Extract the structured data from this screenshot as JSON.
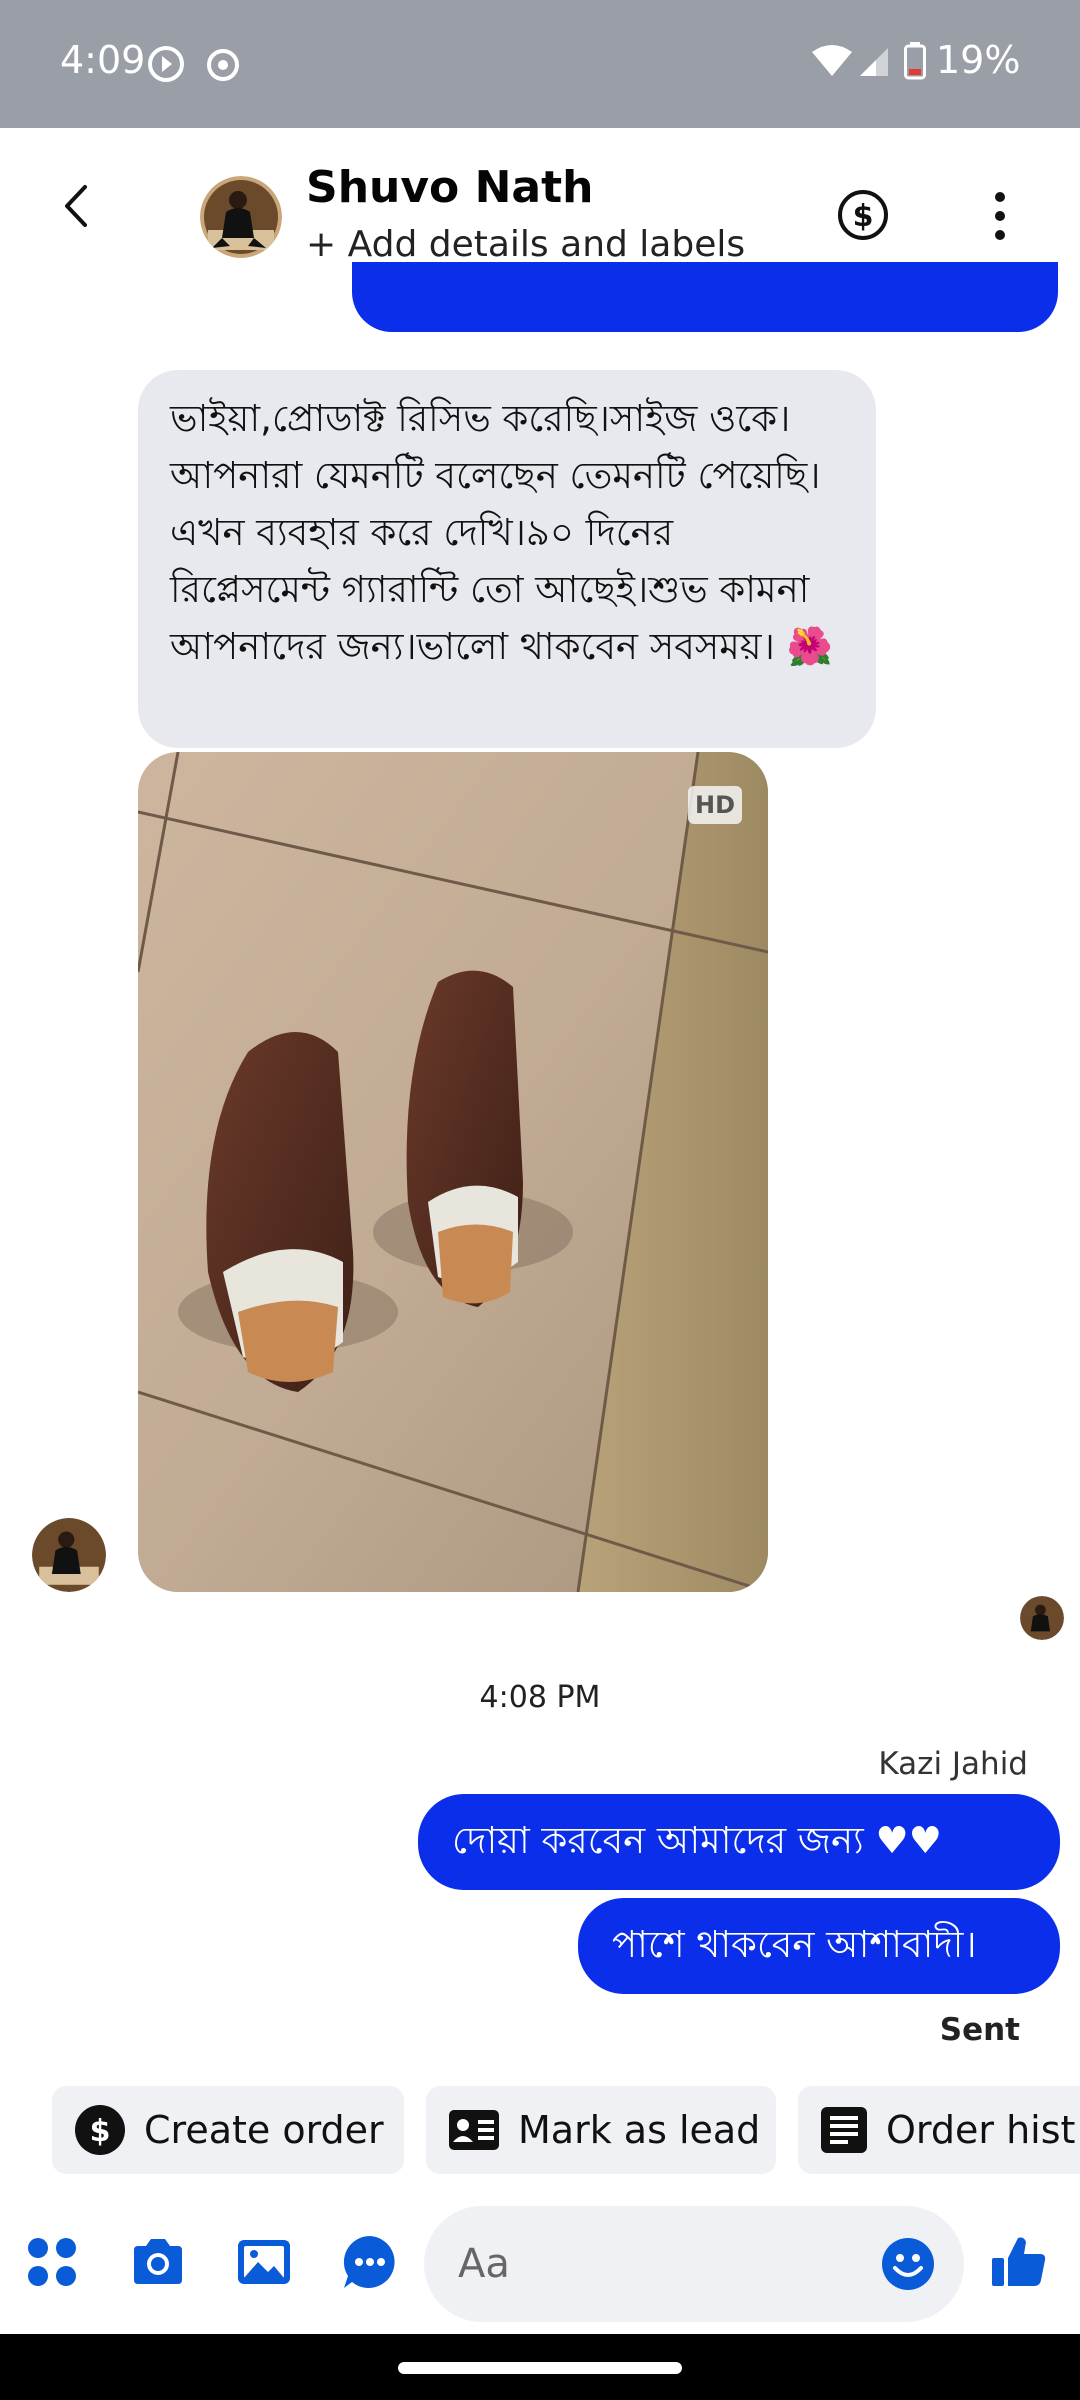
{
  "status_bar": {
    "time": "4:09",
    "battery": "19%"
  },
  "header": {
    "name": "Shuvo Nath",
    "subtitle": "+ Add details and labels"
  },
  "messages": {
    "incoming_text": "ভাইয়া,প্রোডাক্ট রিসিভ করেছি।সাইজ ওকে।আপনারা যেমনটি বলেছেন তেমনটি পেয়েছি।এখন ব্যবহার করে দেখি।৯০ দিনের রিপ্লেসমেন্ট গ্যারান্টি তো আছেই।শুভ কামনা আপনাদের জন্য।ভালো থাকবেন সবসময়। 🌺",
    "photo_badge": "HD",
    "timestamp": "4:08 PM",
    "sender_name": "Kazi Jahid",
    "outgoing": [
      "দোয়া করবেন আমাদের জন্য ♥♥",
      "পাশে থাকবেন আশাবাদী।"
    ],
    "status": "Sent"
  },
  "quick_actions": [
    {
      "label": "Create order",
      "icon": "dollar-circle-icon"
    },
    {
      "label": "Mark as lead",
      "icon": "id-card-icon"
    },
    {
      "label": "Order hist",
      "icon": "receipt-icon"
    }
  ],
  "composer": {
    "placeholder": "Aa"
  },
  "colors": {
    "accent": "#0a2eea",
    "incoming_bg": "#e7e9ee",
    "icon_blue": "#0a5bd8"
  }
}
